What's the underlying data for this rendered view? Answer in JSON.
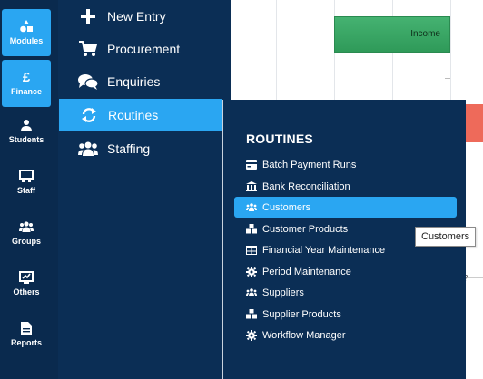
{
  "rail": {
    "items": [
      {
        "label": "Modules",
        "icon": "shapes-icon",
        "active": true
      },
      {
        "label": "Finance",
        "icon": "pound-icon",
        "active": true
      },
      {
        "label": "Students",
        "icon": "user-icon",
        "active": false
      },
      {
        "label": "Staff",
        "icon": "chalkboard-icon",
        "active": false
      },
      {
        "label": "Groups",
        "icon": "users-icon",
        "active": false
      },
      {
        "label": "Others",
        "icon": "chart-icon",
        "active": false
      },
      {
        "label": "Reports",
        "icon": "document-icon",
        "active": false
      }
    ]
  },
  "nav": {
    "items": [
      {
        "label": "New Entry",
        "icon": "plus-icon"
      },
      {
        "label": "Procurement",
        "icon": "cart-icon"
      },
      {
        "label": "Enquiries",
        "icon": "comments-icon"
      },
      {
        "label": "Routines",
        "icon": "sync-icon",
        "active": true
      },
      {
        "label": "Staffing",
        "icon": "users-icon"
      }
    ]
  },
  "chart": {
    "bar_label": "Income",
    "partial_text": "?"
  },
  "panel": {
    "title": "ROUTINES",
    "items": [
      {
        "label": "Batch Payment Runs",
        "icon": "credit-card-icon"
      },
      {
        "label": "Bank Reconciliation",
        "icon": "bank-icon"
      },
      {
        "label": "Customers",
        "icon": "users-icon",
        "active": true
      },
      {
        "label": "Customer Products",
        "icon": "cubes-icon"
      },
      {
        "label": "Financial Year Maintenance",
        "icon": "table-icon"
      },
      {
        "label": "Period Maintenance",
        "icon": "cog-icon"
      },
      {
        "label": "Suppliers",
        "icon": "users-icon"
      },
      {
        "label": "Supplier Products",
        "icon": "cubes-icon"
      },
      {
        "label": "Workflow Manager",
        "icon": "cog-icon"
      }
    ]
  },
  "tooltip": {
    "text": "Customers"
  },
  "colors": {
    "rail_bg": "#0a2a4e",
    "nav_bg": "#0b2e55",
    "accent": "#2aa6f2",
    "income_bar": "#3aa866",
    "red_bar": "#ee6a5a"
  }
}
